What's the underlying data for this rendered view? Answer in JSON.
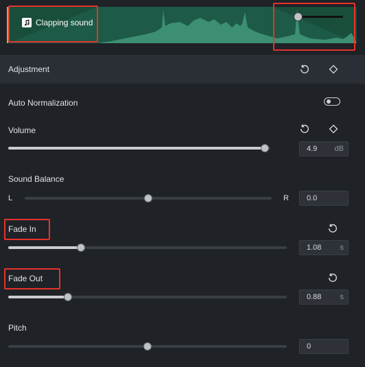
{
  "clip": {
    "name": "Clapping sound",
    "icon": "music-note-icon",
    "waveform_color": "#3d8f73"
  },
  "adjustment": {
    "title": "Adjustment",
    "reset_icon": "reset-icon",
    "keyframe_icon": "keyframe-diamond-icon"
  },
  "auto_normalization": {
    "label": "Auto Normalization",
    "enabled": false
  },
  "volume": {
    "label": "Volume",
    "value": "4.9",
    "unit": "dB",
    "level": 0.98
  },
  "sound_balance": {
    "label": "Sound Balance",
    "left": "L",
    "right": "R",
    "value": "0.0",
    "level": 0.5
  },
  "fade_in": {
    "label": "Fade In",
    "value": "1.08",
    "unit": "s",
    "level": 0.26
  },
  "fade_out": {
    "label": "Fade Out",
    "value": "0.88",
    "unit": "s",
    "level": 0.215
  },
  "pitch": {
    "label": "Pitch",
    "value": "0",
    "level": 0.5
  },
  "colors": {
    "highlight": "#e8322a",
    "background": "#1f2227",
    "clip": "#1d5a47"
  }
}
